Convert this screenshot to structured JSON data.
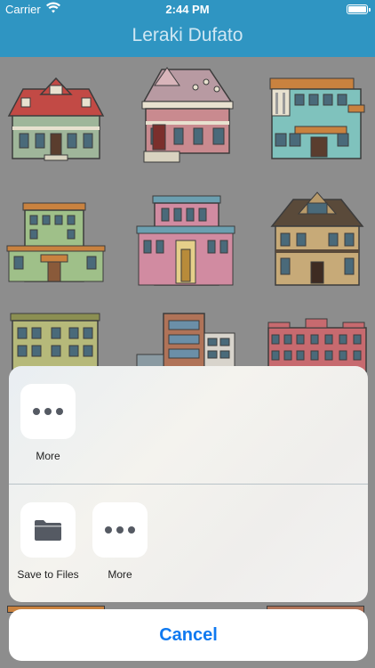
{
  "status_bar": {
    "carrier": "Carrier",
    "time": "2:44 PM"
  },
  "nav": {
    "title": "Leraki Dufato"
  },
  "colors": {
    "nav_bar": "#2f95c2",
    "accent": "#0f79f0"
  },
  "grid": {
    "items": [
      {
        "name": "victorian-red-house"
      },
      {
        "name": "pink-mansion"
      },
      {
        "name": "teal-townhouse"
      },
      {
        "name": "green-manor"
      },
      {
        "name": "pink-palace"
      },
      {
        "name": "brown-tudor-house"
      },
      {
        "name": "olive-apartment"
      },
      {
        "name": "brick-office-towers"
      },
      {
        "name": "red-row-houses"
      }
    ]
  },
  "share_sheet": {
    "row1": [
      {
        "label": "More",
        "icon": "more-icon"
      }
    ],
    "row2": [
      {
        "label": "Save to Files",
        "icon": "folder-icon"
      },
      {
        "label": "More",
        "icon": "more-icon"
      }
    ],
    "cancel_label": "Cancel"
  }
}
